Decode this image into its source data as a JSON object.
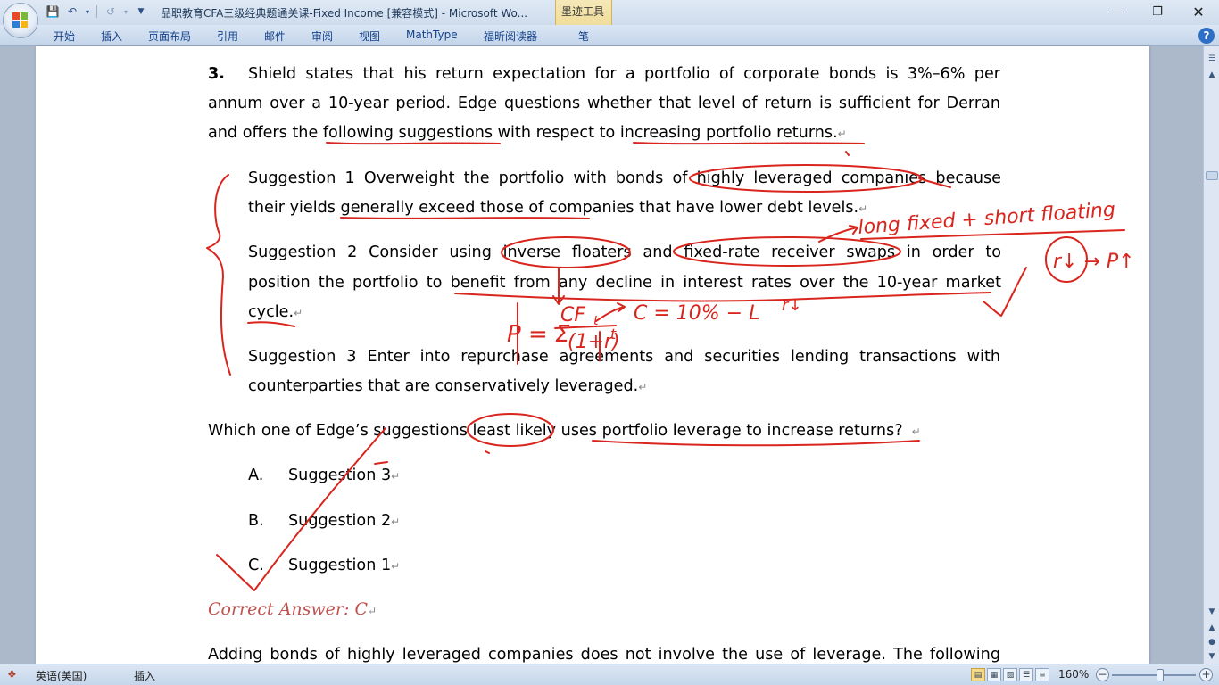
{
  "window": {
    "title": "品职教育CFA三级经典题通关课-Fixed Income [兼容模式] - Microsoft Wo...",
    "contextual_tab": "墨迹工具"
  },
  "ribbon": {
    "tabs": [
      "开始",
      "插入",
      "页面布局",
      "引用",
      "邮件",
      "审阅",
      "视图",
      "MathType",
      "福昕阅读器",
      "笔"
    ]
  },
  "document": {
    "question_number": "3.",
    "intro_lines": [
      "Shield states that his return expectation for a portfolio of corporate bonds is 3%–6% per",
      "annum over a 10-year period. Edge questions whether that level of return is sufficient for Derran",
      "and offers the following suggestions with respect to increasing portfolio returns."
    ],
    "suggestions": [
      {
        "lines": [
          "Suggestion 1 Overweight the portfolio with bonds of highly leveraged companies because",
          "their yields generally exceed those of companies that have lower debt levels."
        ]
      },
      {
        "lines": [
          "Suggestion 2 Consider using inverse floaters and fixed-rate receiver swaps in order to",
          "position the portfolio to benefit from any decline in interest rates over the 10-year market",
          "cycle."
        ]
      },
      {
        "lines": [
          "Suggestion 3 Enter into repurchase agreements and securities lending transactions with",
          "counterparties that are conservatively leveraged."
        ]
      }
    ],
    "question": "Which one of Edge’s suggestions least likely uses portfolio leverage to increase returns?",
    "options": [
      {
        "letter": "A.",
        "text": "Suggestion 3"
      },
      {
        "letter": "B.",
        "text": "Suggestion 2"
      },
      {
        "letter": "C.",
        "text": "Suggestion 1"
      }
    ],
    "correct_answer": "Correct Answer: C",
    "explanation_line": "Adding bonds of highly leveraged companies does not involve the use of leverage. The following",
    "para_mark": "↵"
  },
  "ink": {
    "annotation_top": "long fixed + short floating",
    "annotation_r": "r↓ → P↑",
    "formula_p": "P = Σ",
    "formula_num": "CF",
    "formula_sub": "t",
    "formula_den": "(1+r)",
    "formula_exp": "t",
    "formula_c": "C = 10% − L",
    "r_down": "r↓"
  },
  "statusbar": {
    "language": "英语(美国)",
    "insert_mode": "插入",
    "zoom": "160%"
  },
  "colors": {
    "ink": "#d9251d",
    "correct_answer": "#c0504d",
    "ribbon_text": "#15428b"
  }
}
